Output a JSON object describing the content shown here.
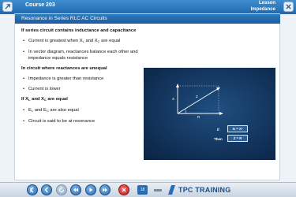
{
  "header": {
    "course_title": "Course 203",
    "lesson_label": "Lesson",
    "lesson_name": "Impedance",
    "left_icon": "expand-icon",
    "right_icon": "close-icon"
  },
  "topic": {
    "title": "Resonance in Series RLC AC Circuits"
  },
  "content": {
    "heading1": "If series circuit contains inductance and capacitance",
    "bullet1_pre": "Current is greatest when X",
    "bullet1_sub1": "L",
    "bullet1_mid": " and X",
    "bullet1_sub2": "C",
    "bullet1_post": " are equal",
    "bullet2": "In vector diagram, reactances balance each other and impedance equals resistance",
    "heading2": "In circuit where reactances are unequal",
    "bullet3": "Impedance is greater than resistance",
    "bullet4": "Current is lower",
    "heading3_pre": "If X",
    "heading3_sub1": "L",
    "heading3_mid": " and X",
    "heading3_sub2": "C",
    "heading3_post": " are equal",
    "bullet5_pre": "E",
    "bullet5_sub1": "L",
    "bullet5_mid": " and E",
    "bullet5_sub2": "C",
    "bullet5_post": " are also equal",
    "bullet6": "Circuit is said to be at resonance"
  },
  "diagram": {
    "label_vertical": "X",
    "label_hyp": "Z",
    "label_base": "R",
    "if_label": "If",
    "then_label": "Then",
    "if_value": "Xₗ = Xᶜ",
    "then_value": "Z = R",
    "bg_color": "#102f55",
    "line_color": "#ffffff"
  },
  "footer": {
    "page_number": "18",
    "logo_text": "TPC TRAINING",
    "buttons": [
      "exit-icon",
      "back-icon",
      "replay-icon",
      "rewind-icon",
      "play-icon",
      "forward-icon",
      "cancel-icon"
    ]
  },
  "colors": {
    "header_blue": "#1f67ad",
    "accent": "#2a6db0",
    "close_red": "#c71d1d"
  }
}
